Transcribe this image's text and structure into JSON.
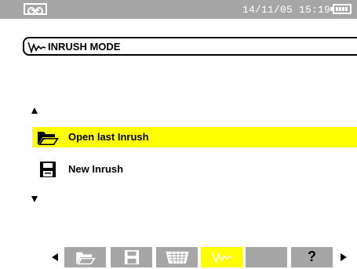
{
  "status_bar": {
    "datetime": "14/11/05 15:19",
    "left_icon": "tape-recorder-icon",
    "right_icon": "battery-icon",
    "background": "#a6a6a6"
  },
  "mode_header": {
    "title": "INRUSH MODE",
    "icon": "inrush-wave-icon"
  },
  "menu": {
    "scroll_up_icon": "scroll-up-arrow-icon",
    "scroll_down_icon": "scroll-down-arrow-icon",
    "items": [
      {
        "label": "Open last Inrush",
        "icon": "open-folder-icon",
        "selected": true
      },
      {
        "label": "New Inrush",
        "icon": "floppy-disk-icon",
        "selected": false
      }
    ],
    "highlight_color": "#ffff00"
  },
  "function_keys": {
    "left_nav_icon": "previous-arrow-icon",
    "right_nav_icon": "next-arrow-icon",
    "keys": [
      {
        "icon": "open-folder-icon",
        "active": false
      },
      {
        "icon": "floppy-disk-icon",
        "active": false
      },
      {
        "icon": "trash-basket-icon",
        "active": false
      },
      {
        "icon": "inrush-wave-icon",
        "active": true
      },
      {
        "icon": "blank-key",
        "active": false
      },
      {
        "icon": "help-icon",
        "label": "?",
        "active": false
      }
    ],
    "key_color": "#a6a6a6",
    "active_color": "#ffff00"
  }
}
